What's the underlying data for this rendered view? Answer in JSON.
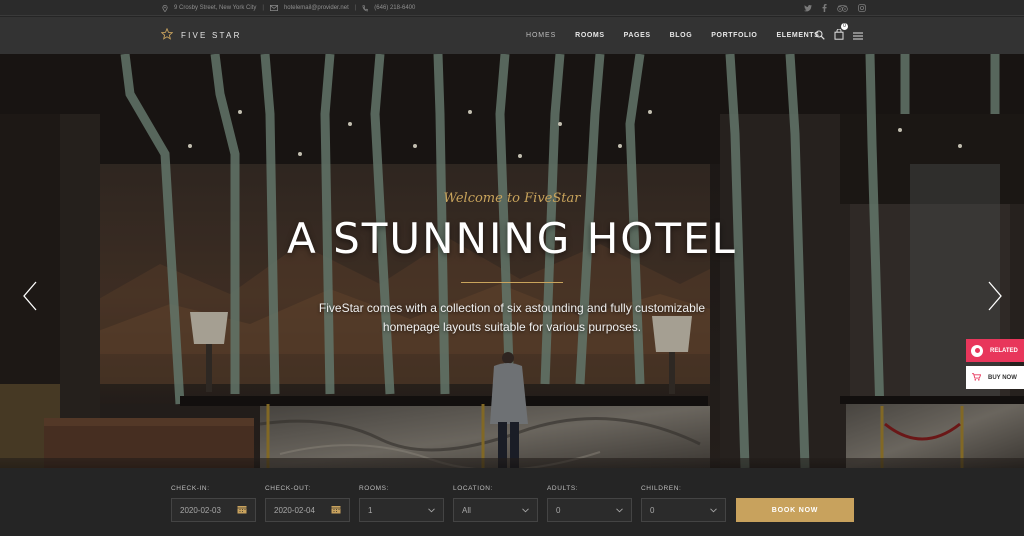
{
  "topbar": {
    "address": "9 Crosby Street, New York City",
    "email": "hotelemail@provider.net",
    "phone": "(646) 218-6400",
    "social_icons": [
      "twitter-icon",
      "facebook-icon",
      "tripadvisor-icon",
      "instagram-icon"
    ]
  },
  "brand": {
    "name": "FIVE STAR"
  },
  "menu": [
    {
      "label": "HOMES",
      "active": true
    },
    {
      "label": "ROOMS"
    },
    {
      "label": "PAGES"
    },
    {
      "label": "BLOG"
    },
    {
      "label": "PORTFOLIO"
    },
    {
      "label": "ELEMENTS"
    }
  ],
  "cart": {
    "count": "0"
  },
  "hero": {
    "kicker": "Welcome to FiveStar",
    "title": "A STUNNING HOTEL",
    "line1": "FiveStar comes with a collection of six astounding and fully customizable",
    "line2": "homepage layouts suitable for various purposes."
  },
  "side": {
    "related": "RELATED",
    "buy": "BUY NOW"
  },
  "booking": {
    "checkin": {
      "label": "CHECK-IN:",
      "value": "2020-02-03"
    },
    "checkout": {
      "label": "CHECK-OUT:",
      "value": "2020-02-04"
    },
    "rooms": {
      "label": "ROOMS:",
      "value": "1"
    },
    "location": {
      "label": "LOCATION:",
      "value": "All"
    },
    "adults": {
      "label": "ADULTS:",
      "value": "0"
    },
    "children": {
      "label": "CHILDREN:",
      "value": "0"
    },
    "button": "BOOK NOW"
  },
  "colors": {
    "accent": "#c8a25d",
    "related": "#e8365b",
    "nav_bg": "#333333",
    "bar_bg": "#252525"
  }
}
